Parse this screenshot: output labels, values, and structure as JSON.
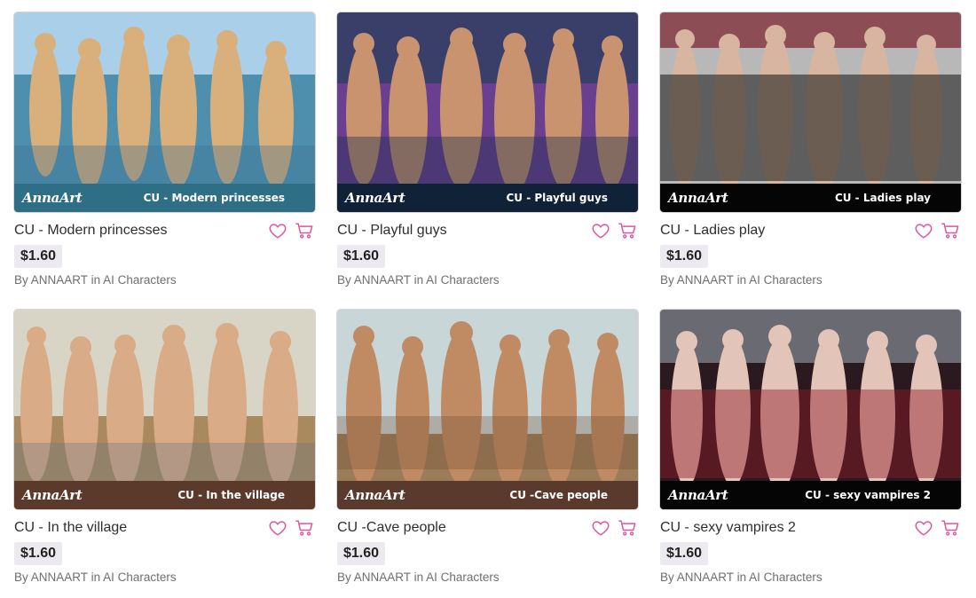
{
  "products": [
    {
      "title": "CU - Modern princesses",
      "price": "$1.60",
      "by_prefix": "By",
      "author": "ANNAART",
      "in_word": "in",
      "category": "AI Characters",
      "banner_brand": "AnnaArt",
      "banner_title": "CU - Modern princesses",
      "banner_color": "#2f6f86",
      "scene_colors": [
        "#a9d0e8",
        "#4e8fae",
        "#d9b07c",
        "#3c6e8e"
      ],
      "favorite_icon": "heart-outline-icon",
      "cart_icon": "cart-icon"
    },
    {
      "title": "CU - Playful guys",
      "price": "$1.60",
      "by_prefix": "By",
      "author": "ANNAART",
      "in_word": "in",
      "category": "AI Characters",
      "banner_brand": "AnnaArt",
      "banner_title": "CU - Playful guys",
      "banner_color": "#0f2238",
      "scene_colors": [
        "#3a3f6a",
        "#6b3f8f",
        "#c99370",
        "#1f2f4a"
      ],
      "favorite_icon": "heart-outline-icon",
      "cart_icon": "cart-icon"
    },
    {
      "title": "CU - Ladies play",
      "price": "$1.60",
      "by_prefix": "By",
      "author": "ANNAART",
      "in_word": "in",
      "category": "AI Characters",
      "banner_brand": "AnnaArt",
      "banner_title": "CU - Ladies play",
      "banner_color": "#050505",
      "scene_colors": [
        "#b8b8b8",
        "#7a1f2a",
        "#d7b5a0",
        "#141414"
      ],
      "favorite_icon": "heart-outline-icon",
      "cart_icon": "cart-icon"
    },
    {
      "title": "CU - In the village",
      "price": "$1.60",
      "by_prefix": "By",
      "author": "ANNAART",
      "in_word": "in",
      "category": "AI Characters",
      "banner_brand": "AnnaArt",
      "banner_title": "CU - In the village",
      "banner_color": "#5b3a2b",
      "scene_colors": [
        "#d8d4c6",
        "#a98a5e",
        "#d9ab86",
        "#5e6f86"
      ],
      "favorite_icon": "heart-outline-icon",
      "cart_icon": "cart-icon"
    },
    {
      "title": "CU -Cave people",
      "price": "$1.60",
      "by_prefix": "By",
      "author": "ANNAART",
      "in_word": "in",
      "category": "AI Characters",
      "banner_brand": "AnnaArt",
      "banner_title": "CU -Cave people",
      "banner_color": "#5a3a2c",
      "scene_colors": [
        "#c9d6d8",
        "#9c7b58",
        "#c08a62",
        "#6c4b35"
      ],
      "favorite_icon": "heart-outline-icon",
      "cart_icon": "cart-icon"
    },
    {
      "title": "CU - sexy vampires 2",
      "price": "$1.60",
      "by_prefix": "By",
      "author": "ANNAART",
      "in_word": "in",
      "category": "AI Characters",
      "banner_brand": "AnnaArt",
      "banner_title": "CU - sexy vampires 2",
      "banner_color": "#050505",
      "scene_colors": [
        "#6a6a72",
        "#2a1a1f",
        "#e2c4b8",
        "#8e1a26"
      ],
      "favorite_icon": "heart-outline-icon",
      "cart_icon": "cart-icon"
    }
  ],
  "accent_color": "#e0559a"
}
